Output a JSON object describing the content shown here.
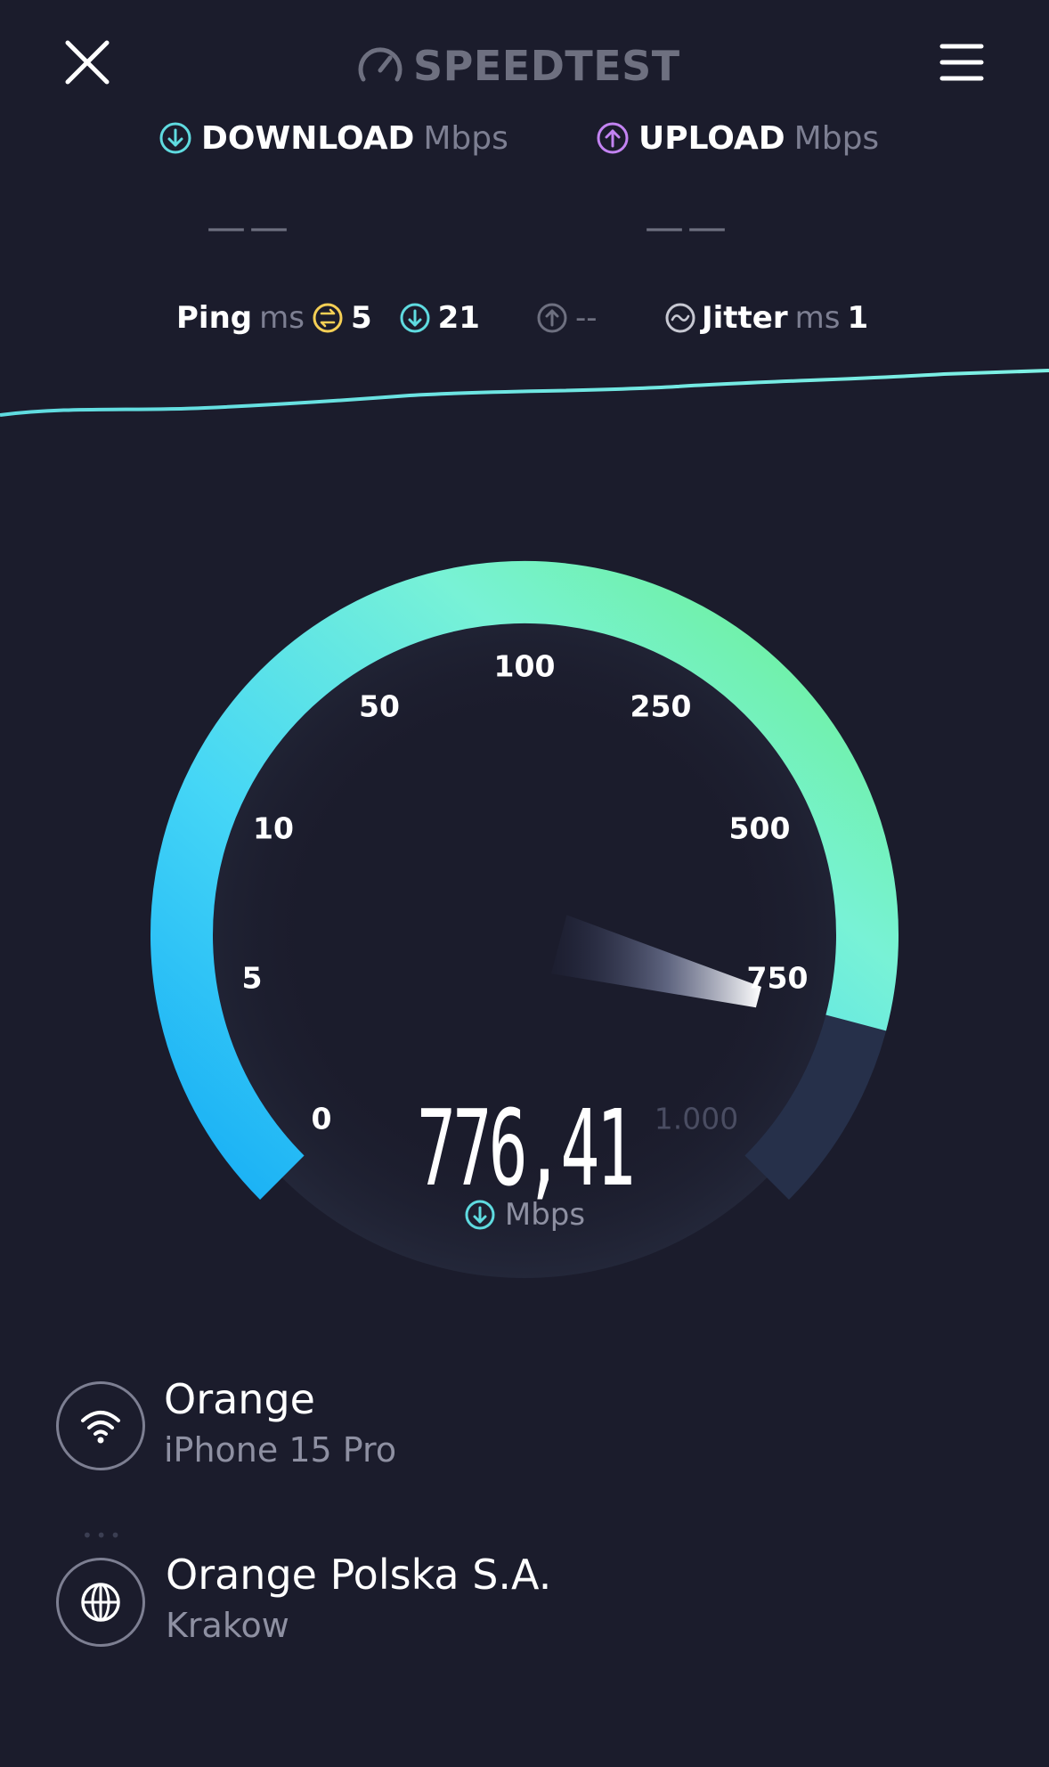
{
  "header": {
    "brand": "SPEEDTEST"
  },
  "download": {
    "label": "DOWNLOAD",
    "unit": "Mbps",
    "value": "——"
  },
  "upload": {
    "label": "UPLOAD",
    "unit": "Mbps",
    "value": "——"
  },
  "ping": {
    "label": "Ping",
    "unit": "ms",
    "idle": "5",
    "download": "21",
    "upload": "--"
  },
  "jitter": {
    "label": "Jitter",
    "unit": "ms",
    "value": "1"
  },
  "gauge": {
    "ticks": [
      "0",
      "5",
      "10",
      "50",
      "100",
      "250",
      "500",
      "750",
      "1.000"
    ],
    "current_value": "776,41",
    "unit": "Mbps",
    "needle_mbps": 776.41
  },
  "connection": {
    "provider": "Orange",
    "device": "iPhone 15 Pro",
    "server": "Orange Polska S.A.",
    "city": "Krakow"
  },
  "colors": {
    "background": "#1b1c2c",
    "download_accent": "#5fdbe0",
    "upload_accent": "#c383f2",
    "ping_idle_accent": "#f5cf55",
    "gauge_start": "#1fb6f5",
    "gauge_end": "#6cf09a"
  }
}
